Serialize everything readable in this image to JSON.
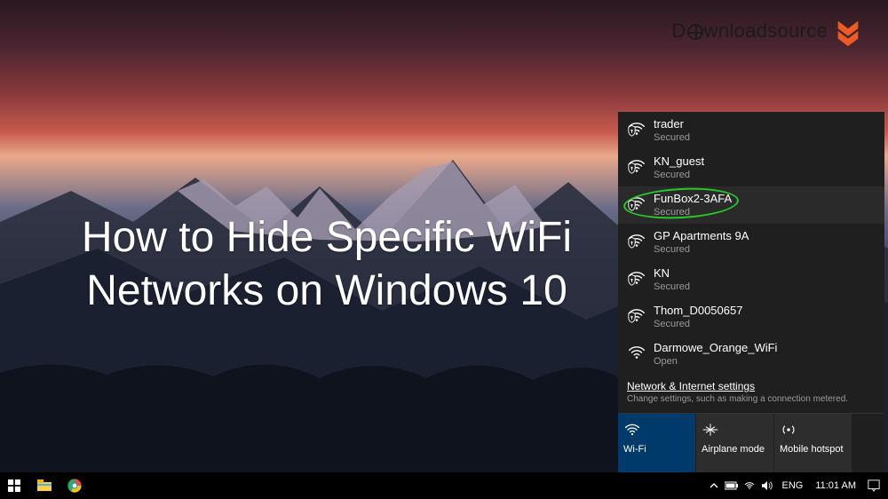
{
  "brand": {
    "prefix": "D",
    "mid": "wnload",
    "suffix": "source"
  },
  "overlay": {
    "title_l1": "How to Hide Specific WiFi",
    "title_l2": "Networks on Windows 10"
  },
  "wifi": {
    "networks": [
      {
        "ssid": "trader",
        "status": "Secured",
        "secured": true,
        "highlighted": false
      },
      {
        "ssid": "KN_guest",
        "status": "Secured",
        "secured": true,
        "highlighted": false
      },
      {
        "ssid": "FunBox2-3AFA",
        "status": "Secured",
        "secured": true,
        "highlighted": true
      },
      {
        "ssid": "GP Apartments 9A",
        "status": "Secured",
        "secured": true,
        "highlighted": false
      },
      {
        "ssid": "KN",
        "status": "Secured",
        "secured": true,
        "highlighted": false
      },
      {
        "ssid": "Thom_D0050657",
        "status": "Secured",
        "secured": true,
        "highlighted": false
      },
      {
        "ssid": "Darmowe_Orange_WiFi",
        "status": "Open",
        "secured": false,
        "highlighted": false
      }
    ],
    "settings_link": "Network & Internet settings",
    "settings_hint": "Change settings, such as making a connection metered.",
    "tiles": {
      "wifi": "Wi-Fi",
      "airplane": "Airplane mode",
      "hotspot": "Mobile hotspot"
    }
  },
  "taskbar": {
    "language": "ENG",
    "clock": "11:01 AM"
  }
}
